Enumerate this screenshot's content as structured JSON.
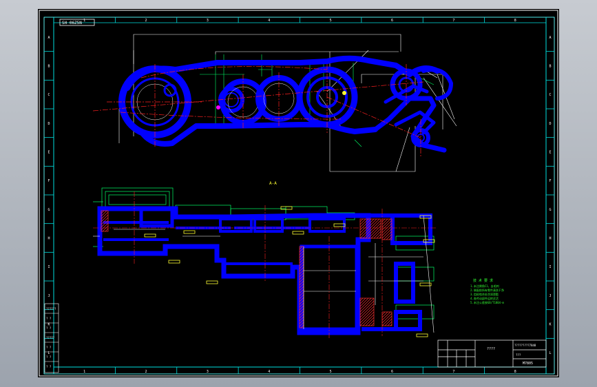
{
  "drawing": {
    "drawing_number": "SH 06Z5N",
    "section_label": "A-A",
    "tech_notes_title": "技 术 要 求",
    "tech_notes": [
      "1.未注倒角C1，去毛刺",
      "2.装配前所有零件清洗干净",
      "3.齿轮啮合处涂润滑脂",
      "4.各传动部件运转灵活",
      "5.未注公差按GB/T1804-m"
    ],
    "title_block": {
      "name": "????",
      "code": "?????????7848",
      "material": "???",
      "sheet": "M7805"
    },
    "zone_numbers": [
      "1",
      "2",
      "3",
      "4",
      "5",
      "6",
      "7",
      "8"
    ],
    "zone_letters": [
      "A",
      "B",
      "C",
      "D",
      "E",
      "F",
      "G",
      "H",
      "I",
      "J",
      "K",
      "L"
    ],
    "left_strip_labels": [
      "??????",
      "? ?",
      "? ?",
      "?????",
      "? ?",
      "? ?",
      "? ?"
    ]
  },
  "colors": {
    "border": "#ffffff",
    "frame": "#00e0e0",
    "part": "#0000ff",
    "centerline": "#ff2020",
    "dimension": "#ffffff",
    "hatch": "#ff3030",
    "note": "#33ff33",
    "label": "#ffff33"
  }
}
